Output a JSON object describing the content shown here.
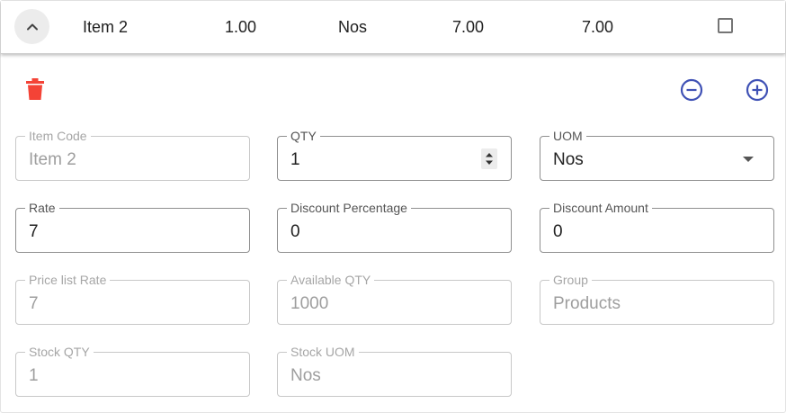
{
  "row": {
    "item_name": "Item 2",
    "qty": "1.00",
    "uom": "Nos",
    "rate": "7.00",
    "amount": "7.00",
    "selected": false
  },
  "icons": {
    "expand": "chevron-up-icon",
    "delete": "trash-icon",
    "decrease": "minus-circle-icon",
    "increase": "plus-circle-icon"
  },
  "colors": {
    "delete": "#f44336",
    "accent": "#3f51b5"
  },
  "fields": {
    "item_code": {
      "label": "Item Code",
      "value": "Item 2"
    },
    "qty": {
      "label": "QTY",
      "value": "1"
    },
    "uom": {
      "label": "UOM",
      "value": "Nos"
    },
    "rate": {
      "label": "Rate",
      "value": "7"
    },
    "discount_percentage": {
      "label": "Discount Percentage",
      "value": "0"
    },
    "discount_amount": {
      "label": "Discount Amount",
      "value": "0"
    },
    "price_list_rate": {
      "label": "Price list Rate",
      "value": "7"
    },
    "available_qty": {
      "label": "Available QTY",
      "value": "1000"
    },
    "group": {
      "label": "Group",
      "value": "Products"
    },
    "stock_qty": {
      "label": "Stock QTY",
      "value": "1"
    },
    "stock_uom": {
      "label": "Stock UOM",
      "value": "Nos"
    }
  }
}
